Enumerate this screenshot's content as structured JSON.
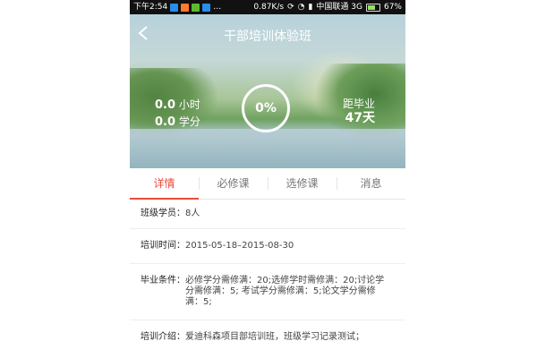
{
  "status_bar": {
    "time": "下午2:54",
    "speed": "0.87K/s",
    "carrier": "中国联通 3G",
    "battery": "67%"
  },
  "header": {
    "title": "干部培训体验班"
  },
  "hero": {
    "hours_value": "0.0",
    "hours_unit": "小时",
    "credits_value": "0.0",
    "credits_unit": "学分",
    "progress_label": "0%",
    "progress_fraction": 0,
    "graduation_label": "距毕业",
    "graduation_days": "47天"
  },
  "tabs": [
    {
      "label": "详情",
      "active": true
    },
    {
      "label": "必修课",
      "active": false
    },
    {
      "label": "选修课",
      "active": false
    },
    {
      "label": "消息",
      "active": false
    }
  ],
  "details": [
    {
      "key": "班级学员：",
      "value": "8人"
    },
    {
      "key": "培训时间：",
      "value": "2015-05-18–2015-08-30"
    },
    {
      "key": "毕业条件：",
      "value": "必修学分需修满：20;选修学时需修满：20;讨论学分需修满：5; 考试学分需修满：5;论文学分需修满：5;"
    },
    {
      "key": "培训介绍：",
      "value": "爱迪科森项目部培训班，班级学习记录测试；"
    }
  ],
  "colors": {
    "accent": "#e74c3c",
    "status_bar": "#111111"
  },
  "icons": {
    "back": "chevron-left-icon"
  }
}
